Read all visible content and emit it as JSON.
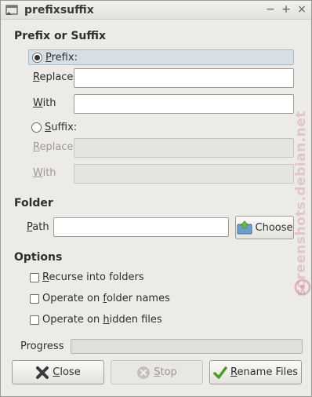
{
  "window": {
    "title": "prefixsuffix",
    "icon": "window-app-icon",
    "controls": [
      "minimize",
      "maximize",
      "close"
    ]
  },
  "prefix_or_suffix": {
    "heading": "Prefix or Suffix",
    "prefix": {
      "label": "Prefix:",
      "selected": true
    },
    "prefix_replace": {
      "label": "Replace",
      "value": ""
    },
    "prefix_with": {
      "label": "With",
      "value": ""
    },
    "suffix": {
      "label": "Suffix:",
      "selected": false
    },
    "suffix_replace": {
      "label": "Replace",
      "value": "",
      "enabled": false
    },
    "suffix_with": {
      "label": "With",
      "value": "",
      "enabled": false
    }
  },
  "folder": {
    "heading": "Folder",
    "path_label": "Path",
    "path_value": "",
    "choose_label": "Choose"
  },
  "options": {
    "heading": "Options",
    "recurse": {
      "label": "Recurse into folders",
      "checked": false
    },
    "folder_names": {
      "label": "Operate on folder names",
      "checked": false
    },
    "hidden_files": {
      "label": "Operate on hidden files",
      "checked": false
    }
  },
  "progress": {
    "label": "Progress",
    "fraction": 0
  },
  "buttons": {
    "close": "Close",
    "stop": "Stop",
    "rename": "Rename Files"
  },
  "watermark": {
    "text": "screenshots.debian.net"
  },
  "colors": {
    "window_bg": "#edebe7",
    "selected_row": "#d7dfe6",
    "disabled_text": "#9b9893",
    "watermark": "#c8788c"
  }
}
